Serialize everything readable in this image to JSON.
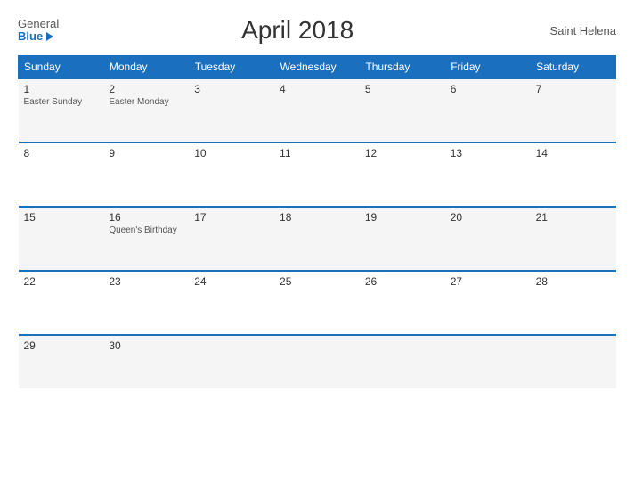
{
  "logo": {
    "general": "General",
    "blue": "Blue",
    "triangle": ""
  },
  "title": "April 2018",
  "region": "Saint Helena",
  "days": [
    "Sunday",
    "Monday",
    "Tuesday",
    "Wednesday",
    "Thursday",
    "Friday",
    "Saturday"
  ],
  "weeks": [
    [
      {
        "num": "1",
        "holiday": "Easter Sunday"
      },
      {
        "num": "2",
        "holiday": "Easter Monday"
      },
      {
        "num": "3",
        "holiday": ""
      },
      {
        "num": "4",
        "holiday": ""
      },
      {
        "num": "5",
        "holiday": ""
      },
      {
        "num": "6",
        "holiday": ""
      },
      {
        "num": "7",
        "holiday": ""
      }
    ],
    [
      {
        "num": "8",
        "holiday": ""
      },
      {
        "num": "9",
        "holiday": ""
      },
      {
        "num": "10",
        "holiday": ""
      },
      {
        "num": "11",
        "holiday": ""
      },
      {
        "num": "12",
        "holiday": ""
      },
      {
        "num": "13",
        "holiday": ""
      },
      {
        "num": "14",
        "holiday": ""
      }
    ],
    [
      {
        "num": "15",
        "holiday": ""
      },
      {
        "num": "16",
        "holiday": "Queen's Birthday"
      },
      {
        "num": "17",
        "holiday": ""
      },
      {
        "num": "18",
        "holiday": ""
      },
      {
        "num": "19",
        "holiday": ""
      },
      {
        "num": "20",
        "holiday": ""
      },
      {
        "num": "21",
        "holiday": ""
      }
    ],
    [
      {
        "num": "22",
        "holiday": ""
      },
      {
        "num": "23",
        "holiday": ""
      },
      {
        "num": "24",
        "holiday": ""
      },
      {
        "num": "25",
        "holiday": ""
      },
      {
        "num": "26",
        "holiday": ""
      },
      {
        "num": "27",
        "holiday": ""
      },
      {
        "num": "28",
        "holiday": ""
      }
    ],
    [
      {
        "num": "29",
        "holiday": ""
      },
      {
        "num": "30",
        "holiday": ""
      },
      {
        "num": "",
        "holiday": ""
      },
      {
        "num": "",
        "holiday": ""
      },
      {
        "num": "",
        "holiday": ""
      },
      {
        "num": "",
        "holiday": ""
      },
      {
        "num": "",
        "holiday": ""
      }
    ]
  ]
}
